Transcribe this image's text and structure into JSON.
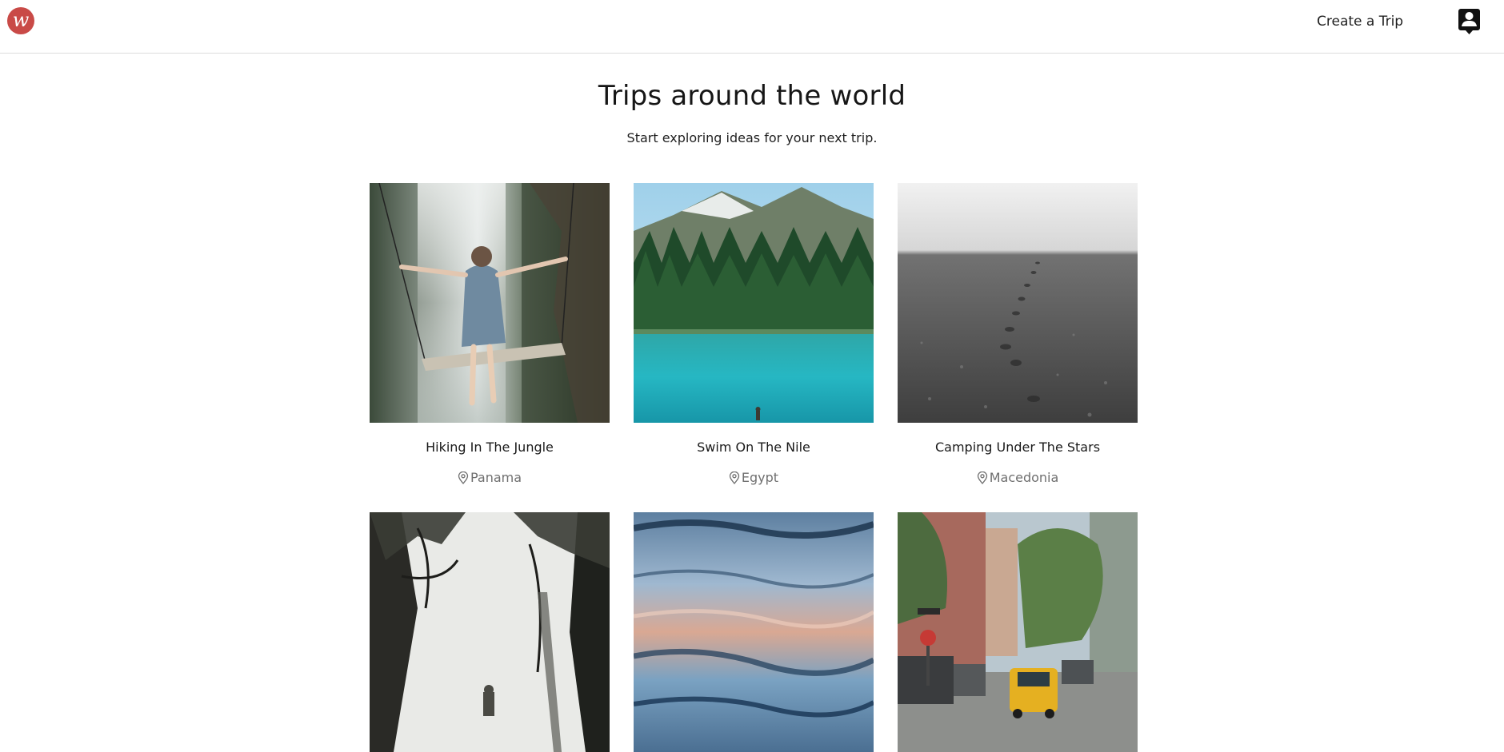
{
  "navbar": {
    "logo_letter": "w",
    "logo_color": "#c94a47",
    "create_trip_label": "Create a Trip",
    "account_icon": "account-box-icon"
  },
  "hero": {
    "title": "Trips around the world",
    "subtitle": "Start exploring ideas for your next trip."
  },
  "trips": [
    {
      "title": "Hiking In The Jungle",
      "location": "Panama",
      "image": "waterfall-swing-photo"
    },
    {
      "title": "Swim On The Nile",
      "location": "Egypt",
      "image": "turquoise-lake-forest-photo"
    },
    {
      "title": "Camping Under The Stars",
      "location": "Macedonia",
      "image": "foggy-footprints-beach-photo"
    },
    {
      "title": "",
      "location": "",
      "image": "misty-forest-trees-photo"
    },
    {
      "title": "",
      "location": "",
      "image": "blue-water-ripples-photo"
    },
    {
      "title": "",
      "location": "",
      "image": "city-street-taxi-photo"
    }
  ],
  "colors": {
    "text": "#1f1f1f",
    "muted": "#6f6f6f",
    "border": "#dcdcdc"
  }
}
